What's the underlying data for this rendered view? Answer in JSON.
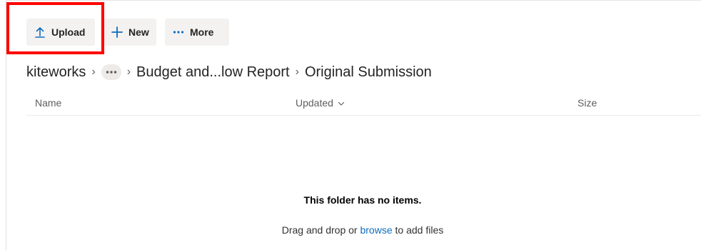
{
  "toolbar": {
    "upload_label": "Upload",
    "new_label": "New",
    "more_label": "More",
    "accent_color": "#0f6cbd"
  },
  "highlight": {
    "color": "#ff0000"
  },
  "breadcrumb": {
    "root": "kiteworks",
    "overflow_icon": "ellipsis-icon",
    "middle": "Budget and...low Report",
    "current": "Original Submission",
    "separator": "›"
  },
  "columns": {
    "name": "Name",
    "updated": "Updated",
    "size": "Size",
    "sort_icon": "chevron-down-icon"
  },
  "empty_state": {
    "title": "This folder has no items.",
    "prefix": "Drag and drop or ",
    "link": "browse",
    "suffix": " to add files"
  }
}
